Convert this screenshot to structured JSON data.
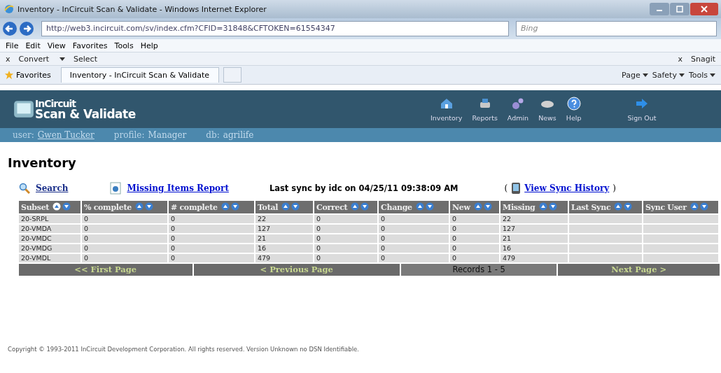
{
  "window": {
    "title": "Inventory - InCircuit Scan & Validate - Windows Internet Explorer"
  },
  "browser": {
    "address": "http://web3.incircuit.com/sv/index.cfm?CFID=31848&CFTOKEN=61554347",
    "search_placeholder": "Bing",
    "menu": [
      "File",
      "Edit",
      "View",
      "Favorites",
      "Tools",
      "Help"
    ],
    "toolbar": {
      "close": "x",
      "convert": "Convert",
      "select": "Select",
      "close_right": "x",
      "snagit": "Snagit"
    },
    "favorites": "Favorites",
    "tab": "Inventory - InCircuit Scan & Validate",
    "commands": [
      "Page",
      "Safety",
      "Tools"
    ]
  },
  "app": {
    "logo": [
      "InCircuit",
      "Scan & Validate"
    ],
    "nav": [
      {
        "label": "Inventory",
        "kind": "house"
      },
      {
        "label": "Reports",
        "kind": "printer"
      },
      {
        "label": "Admin",
        "kind": "gears"
      },
      {
        "label": "News",
        "kind": "paper"
      },
      {
        "label": "Help",
        "kind": "help"
      },
      {
        "label": "Sign Out",
        "kind": "arrow"
      }
    ],
    "user_bar": [
      {
        "label": "user:",
        "value": "Gwen Tucker"
      },
      {
        "label": "profile:",
        "value": "Manager"
      },
      {
        "label": "db:",
        "value": "agrilife"
      }
    ],
    "heading": "Inventory",
    "search_link": "Search",
    "report_link": "Missing Items Report",
    "sync_text": "Last sync by idc on 04/25/11 09:38:09 AM",
    "history_open": "(",
    "history_link": "View Sync History",
    "history_close": ")"
  },
  "table": {
    "columns": [
      {
        "label": "Subset",
        "sorted_asc": true
      },
      {
        "label": "% complete",
        "sorted_asc": false
      },
      {
        "label": "# complete",
        "sorted_asc": false
      },
      {
        "label": "Total",
        "sorted_asc": false
      },
      {
        "label": "Correct",
        "sorted_asc": false
      },
      {
        "label": "Change",
        "sorted_asc": false
      },
      {
        "label": "New",
        "sorted_asc": false
      },
      {
        "label": "Missing",
        "sorted_asc": false
      },
      {
        "label": "Last Sync",
        "sorted_asc": false
      },
      {
        "label": "Sync User",
        "sorted_asc": false
      }
    ],
    "rows": [
      [
        "20-SRPL",
        "0",
        "0",
        "22",
        "0",
        "0",
        "0",
        "22",
        "",
        ""
      ],
      [
        "20-VMDA",
        "0",
        "0",
        "127",
        "0",
        "0",
        "0",
        "127",
        "",
        ""
      ],
      [
        "20-VMDC",
        "0",
        "0",
        "21",
        "0",
        "0",
        "0",
        "21",
        "",
        ""
      ],
      [
        "20-VMDG",
        "0",
        "0",
        "16",
        "0",
        "0",
        "0",
        "16",
        "",
        ""
      ],
      [
        "20-VMDL",
        "0",
        "0",
        "479",
        "0",
        "0",
        "0",
        "479",
        "",
        ""
      ]
    ]
  },
  "pagination": {
    "first": "<< First Page",
    "previous": "< Previous Page",
    "records": "Records 1 - 5",
    "next": "Next Page >"
  },
  "footer": "Copyright © 1993-2011 InCircuit Development Corporation. All rights reserved. Version Unknown no DSN Identifiable."
}
